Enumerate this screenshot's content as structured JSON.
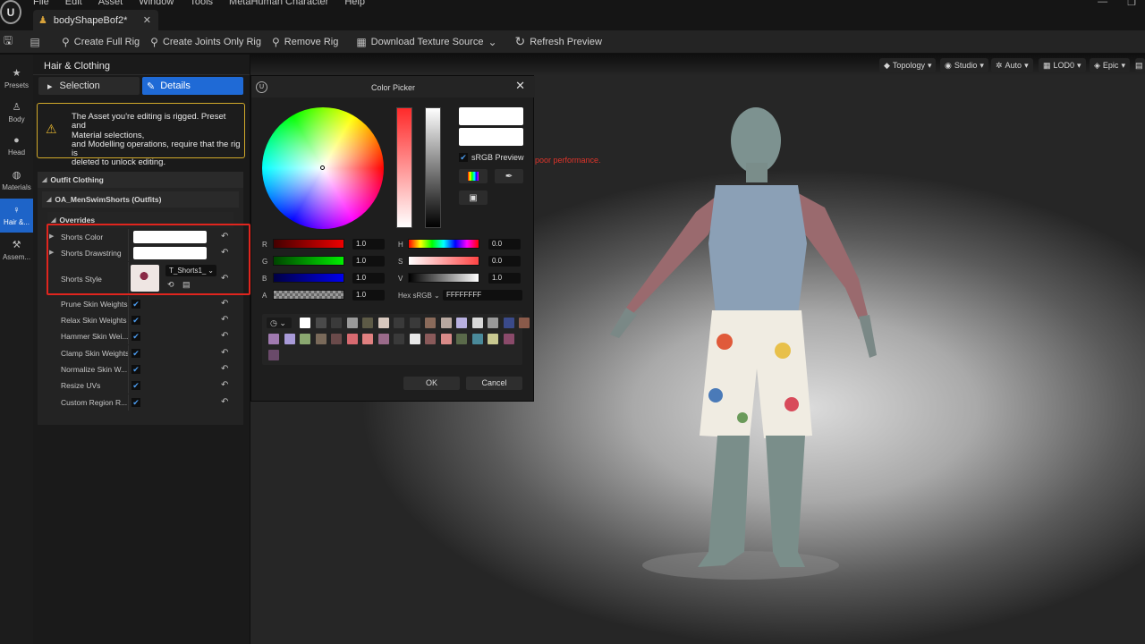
{
  "app": {
    "menu": [
      "File",
      "Edit",
      "Asset",
      "Window",
      "Tools",
      "MetaHuman Character",
      "Help"
    ],
    "document_tab": "bodyShapeBof2*"
  },
  "toolbar": {
    "create_full_rig": "Create Full Rig",
    "create_joints_only_rig": "Create Joints Only Rig",
    "remove_rig": "Remove Rig",
    "download_texture_source": "Download Texture Source",
    "refresh_preview": "Refresh Preview"
  },
  "rail": [
    {
      "label": "Presets",
      "icon": "star-icon"
    },
    {
      "label": "Body",
      "icon": "body-icon"
    },
    {
      "label": "Head",
      "icon": "head-icon"
    },
    {
      "label": "Materials",
      "icon": "materials-icon"
    },
    {
      "label": "Hair &...",
      "icon": "hair-icon"
    },
    {
      "label": "Assem...",
      "icon": "hammer-icon"
    }
  ],
  "panel": {
    "title": "Hair & Clothing",
    "tab_selection": "Selection",
    "tab_details": "Details",
    "warning_lines": [
      "The Asset you're editing is rigged. Preset and",
      "Material selections,",
      "and Modelling operations, require that the rig is",
      "deleted to unlock editing."
    ],
    "category_outfit": "Outfit Clothing",
    "subcategory_asset": "OA_MenSwimShorts (Outfits)",
    "group_overrides": "Overrides",
    "shorts_color": "Shorts Color",
    "shorts_drawstring": "Shorts Drawstring",
    "shorts_style": "Shorts Style",
    "texture_name": "T_Shorts1_",
    "options": [
      "Prune Skin Weights",
      "Relax Skin Weights",
      "Hammer Skin Wei...",
      "Clamp Skin Weights",
      "Normalize Skin W...",
      "Resize UVs",
      "Custom Region R..."
    ]
  },
  "viewport": {
    "chips": [
      "Topology",
      "Studio",
      "Auto",
      "LOD0",
      "Epic"
    ],
    "warning": "poor performance."
  },
  "picker": {
    "title": "Color Picker",
    "srgb_preview": "sRGB Preview",
    "r_label": "R",
    "g_label": "G",
    "b_label": "B",
    "a_label": "A",
    "h_label": "H",
    "s_label": "S",
    "v_label": "V",
    "r": "1.0",
    "g": "1.0",
    "b": "1.0",
    "a": "1.0",
    "h": "0.0",
    "s": "0.0",
    "v": "1.0",
    "hex_label": "Hex sRGB",
    "hex": "FFFFFFFF",
    "ok": "OK",
    "cancel": "Cancel",
    "palette_row1": [
      "#ffffff",
      "#4a4a4a",
      "#3a3a3a",
      "#9a9a9a",
      "#5d5a46",
      "#d8c8be",
      "#3a3a3a",
      "#3a3a3a",
      "#8a6a5a",
      "#b8a8a0",
      "#b8b0e0",
      "#d8d8d8",
      "#9a9a9a",
      "#3a4a8a",
      "#8a5a4a"
    ],
    "palette_row2": [
      "#a07ab0",
      "#a89ad8",
      "#8aa870",
      "#7a6a5a",
      "#6a4a4a",
      "#d86a70",
      "#e08080",
      "#9a6a8a",
      "#3a3a3a",
      "#e8e8e8",
      "#8a5a5a",
      "#d88a88",
      "#5a6a4a",
      "#4a8a9a",
      "#c8c890",
      "#8a4a6a"
    ],
    "palette_row3": [
      "#6a4a6a"
    ]
  }
}
